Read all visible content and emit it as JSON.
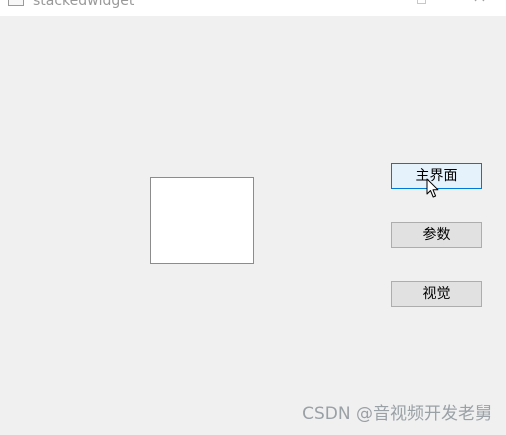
{
  "window": {
    "title": "stackedwidget"
  },
  "buttons": {
    "main_label": "主界面",
    "params_label": "参数",
    "vision_label": "视觉"
  },
  "watermark": {
    "text": "CSDN @音视频开发老舅"
  },
  "colors": {
    "window_bg": "#f0f0f0",
    "button_bg": "#e1e1e1",
    "button_active_bg": "#e5f1fb",
    "button_active_border": "#0078d7",
    "watermark": "#9aa1a6"
  },
  "icons": {
    "app": "app-window-icon",
    "minimize": "minimize-icon",
    "close": "close-icon",
    "cursor": "mouse-pointer-icon"
  }
}
